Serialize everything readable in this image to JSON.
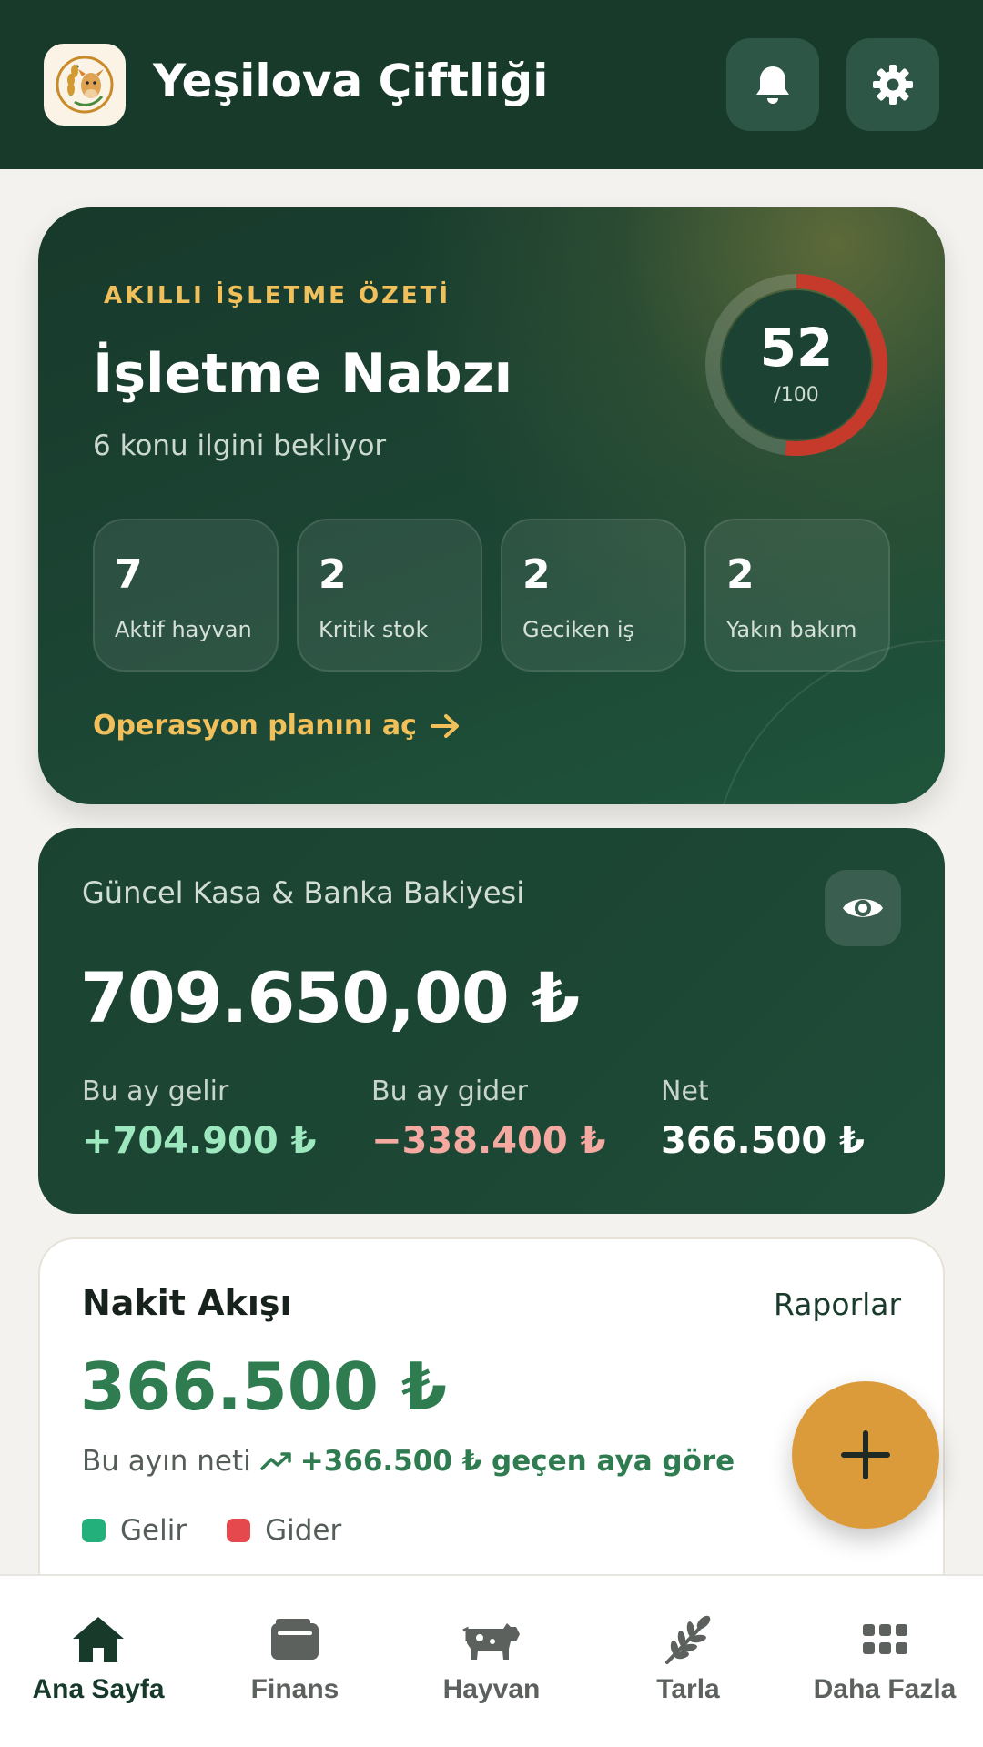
{
  "header": {
    "title": "Yeşilova Çiftliği",
    "logo_icon": "farm-logo-icon",
    "bell_icon": "bell-icon",
    "settings_icon": "gear-icon"
  },
  "pulse": {
    "eyebrow": "AKILLI İŞLETME ÖZETİ",
    "title": "İşletme Nabzı",
    "subtitle": "6 konu ilgini bekliyor",
    "score": "52",
    "score_max": "/100",
    "score_fraction": 0.52,
    "stats": [
      {
        "value": "7",
        "label": "Aktif hayvan"
      },
      {
        "value": "2",
        "label": "Kritik stok"
      },
      {
        "value": "2",
        "label": "Geciken iş"
      },
      {
        "value": "2",
        "label": "Yakın bakım"
      }
    ],
    "link": "Operasyon planını aç"
  },
  "balance": {
    "label": "Güncel Kasa & Banka Bakiyesi",
    "amount": "709.650,00 ₺",
    "income_label": "Bu ay gelir",
    "income_value": "+704.900 ₺",
    "expense_label": "Bu ay gider",
    "expense_value": "−338.400 ₺",
    "net_label": "Net",
    "net_value": "366.500 ₺"
  },
  "cashflow": {
    "title": "Nakit Akışı",
    "link": "Raporlar",
    "amount": "366.500 ₺",
    "subtitle": "Bu ayın neti",
    "trend": "+366.500 ₺ geçen aya göre",
    "legend": [
      {
        "label": "Gelir",
        "color": "#23b07a"
      },
      {
        "label": "Gider",
        "color": "#e5484d"
      }
    ]
  },
  "fab": {
    "icon": "plus-icon"
  },
  "nav": [
    {
      "label": "Ana Sayfa",
      "icon": "home-icon",
      "active": true
    },
    {
      "label": "Finans",
      "icon": "wallet-icon",
      "active": false
    },
    {
      "label": "Hayvan",
      "icon": "cow-icon",
      "active": false
    },
    {
      "label": "Tarla",
      "icon": "wheat-icon",
      "active": false
    },
    {
      "label": "Daha Fazla",
      "icon": "grid-icon",
      "active": false
    }
  ],
  "colors": {
    "primary": "#173a2b",
    "accent": "#f1c05a",
    "fab": "#dc9b3b",
    "score_ring": "#c63a2c",
    "income": "#9ee8bf",
    "expense": "#f4a9a1",
    "cashflow_green": "#2e7c50"
  }
}
